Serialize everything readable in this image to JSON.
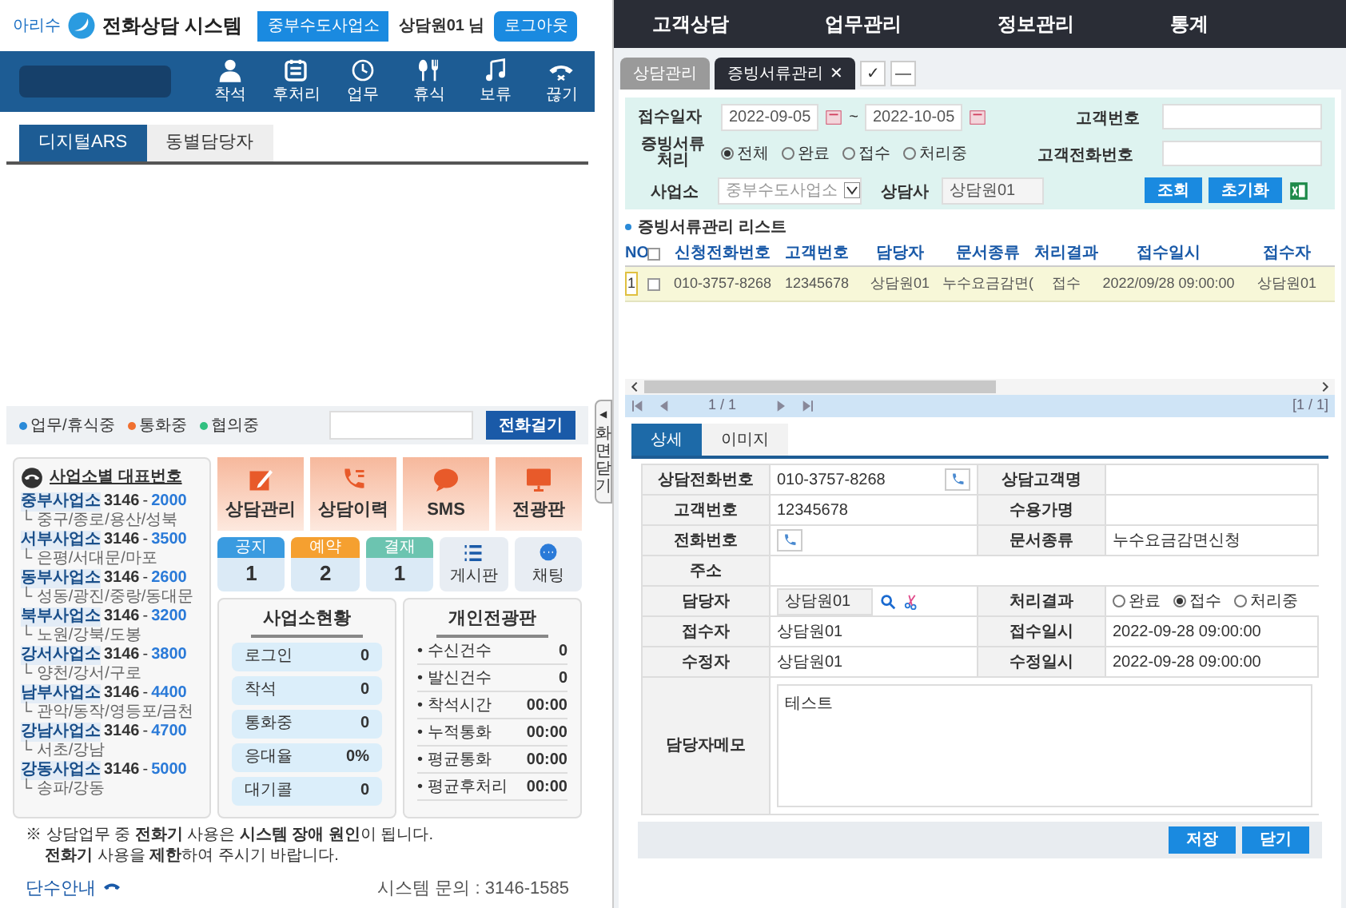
{
  "header": {
    "logo": "아리수",
    "title": "전화상담 시스템",
    "office": "중부수도사업소",
    "user": "상담원01 님",
    "logout": "로그아웃"
  },
  "toolbar": [
    {
      "label": "착석"
    },
    {
      "label": "후처리"
    },
    {
      "label": "업무"
    },
    {
      "label": "휴식"
    },
    {
      "label": "보류"
    },
    {
      "label": "끊기"
    }
  ],
  "left_tabs": [
    {
      "label": "디지털ARS",
      "selected": true
    },
    {
      "label": "동별담당자",
      "selected": false
    }
  ],
  "legend": [
    {
      "label": "업무/휴식중",
      "color": "#2a8ad8"
    },
    {
      "label": "통화중",
      "color": "#f07030"
    },
    {
      "label": "협의중",
      "color": "#30c080"
    }
  ],
  "dial_button": "전화걸기",
  "side_handle": {
    "arrow": "◀",
    "label": "화면닫기"
  },
  "offices": {
    "title": "사업소별 대표번호",
    "items": [
      {
        "name": "중부사업소",
        "prefix": "3146",
        "sep": "-",
        "number": "2000",
        "areas": "└ 중구/종로/용산/성북"
      },
      {
        "name": "서부사업소",
        "prefix": "3146",
        "sep": "-",
        "number": "3500",
        "areas": "└ 은평/서대문/마포"
      },
      {
        "name": "동부사업소",
        "prefix": "3146",
        "sep": "-",
        "number": "2600",
        "areas": "└ 성동/광진/중랑/동대문"
      },
      {
        "name": "북부사업소",
        "prefix": "3146",
        "sep": "-",
        "number": "3200",
        "areas": "└ 노원/강북/도봉"
      },
      {
        "name": "강서사업소",
        "prefix": "3146",
        "sep": "-",
        "number": "3800",
        "areas": "└ 양천/강서/구로"
      },
      {
        "name": "남부사업소",
        "prefix": "3146",
        "sep": "-",
        "number": "4400",
        "areas": "└ 관악/동작/영등포/금천"
      },
      {
        "name": "강남사업소",
        "prefix": "3146",
        "sep": "-",
        "number": "4700",
        "areas": "└ 서초/강남"
      },
      {
        "name": "강동사업소",
        "prefix": "3146",
        "sep": "-",
        "number": "5000",
        "areas": "└ 송파/강동"
      }
    ]
  },
  "menu_tiles": [
    {
      "label": "상담관리"
    },
    {
      "label": "상담이력"
    },
    {
      "label": "SMS"
    },
    {
      "label": "전광판"
    }
  ],
  "counters": [
    {
      "label": "공지",
      "count": "1",
      "color": "#3a9be0"
    },
    {
      "label": "예약",
      "count": "2",
      "color": "#f5a030"
    },
    {
      "label": "결재",
      "count": "1",
      "color": "#6cc4b0"
    }
  ],
  "shortcuts": [
    {
      "label": "게시판"
    },
    {
      "label": "채팅"
    }
  ],
  "office_status": {
    "title": "사업소현황",
    "rows": [
      {
        "label": "로그인",
        "value": "0"
      },
      {
        "label": "착석",
        "value": "0"
      },
      {
        "label": "통화중",
        "value": "0"
      },
      {
        "label": "응대율",
        "value": "0%"
      },
      {
        "label": "대기콜",
        "value": "0"
      }
    ]
  },
  "personal_board": {
    "title": "개인전광판",
    "rows": [
      {
        "label": "• 수신건수",
        "value": "0"
      },
      {
        "label": "• 발신건수",
        "value": "0"
      },
      {
        "label": "• 착석시간",
        "value": "00:00"
      },
      {
        "label": "• 누적통화",
        "value": "00:00"
      },
      {
        "label": "• 평균통화",
        "value": "00:00"
      },
      {
        "label": "• 평균후처리",
        "value": "00:00"
      }
    ]
  },
  "notice": [
    "※ 상담업무 중 **전화기** 사용은 **시스템 장애 원인**이 됩니다.",
    "**전화기** 사용을 **제한**하여 주시기 바랍니다."
  ],
  "footer": {
    "outage": "단수안내",
    "inquiry": "시스템 문의 : 3146-1585"
  },
  "nav": [
    {
      "label": "고객상담"
    },
    {
      "label": "업무관리"
    },
    {
      "label": "정보관리"
    },
    {
      "label": "통계"
    }
  ],
  "tabs": [
    {
      "label": "상담관리",
      "selected": false
    },
    {
      "label": "증빙서류관리",
      "selected": true,
      "close": "✕"
    }
  ],
  "tab_actions": [
    "✓",
    "—"
  ],
  "search": {
    "date_label": "접수일자",
    "date_from": "2022-09-05",
    "tilde": "~",
    "date_to": "2022-10-05",
    "customer_no_label": "고객번호",
    "doc_label": "증빙서류 처리",
    "doc_options": [
      {
        "label": "전체",
        "selected": true
      },
      {
        "label": "완료",
        "selected": false
      },
      {
        "label": "접수",
        "selected": false
      },
      {
        "label": "처리중",
        "selected": false
      }
    ],
    "customer_phone_label": "고객전화번호",
    "office_label": "사업소",
    "office_value": "중부수도사업소",
    "counselor_label": "상담사",
    "counselor_value": "상담원01",
    "buttons": [
      "조회",
      "초기화"
    ]
  },
  "list": {
    "title": "증빙서류관리 리스트",
    "columns": [
      "NO",
      "신청전화번호",
      "고객번호",
      "담당자",
      "문서종류",
      "처리결과",
      "접수일시",
      "접수자"
    ],
    "header_checked": false,
    "rows": [
      {
        "selected": true,
        "checked": false,
        "cells": [
          "1",
          "010-3757-8268",
          "12345678",
          "상담원01",
          "누수요금감면(",
          "접수",
          "2022/09/28 09:00:00",
          "상담원01"
        ]
      }
    ],
    "pager": "1 / 1",
    "total": "[1 / 1]"
  },
  "detail": {
    "tabs": [
      {
        "label": "상세",
        "selected": true
      },
      {
        "label": "이미지",
        "selected": false
      }
    ],
    "cells": [
      {
        "kind": "phone",
        "label": "상담전화번호",
        "value": "010-3757-8268"
      },
      {
        "kind": "text",
        "label": "상담고객명"
      },
      {
        "kind": "text",
        "label": "고객번호",
        "value": "12345678"
      },
      {
        "kind": "text",
        "label": "수용가명"
      },
      {
        "kind": "phone",
        "label": "전화번호"
      },
      {
        "kind": "text",
        "label": "문서종류",
        "value": "누수요금감면신청"
      },
      {
        "kind": "wide",
        "label": "주소"
      },
      {
        "kind": "picker",
        "label": "담당자",
        "value": "상담원01"
      },
      {
        "kind": "radio",
        "label": "처리결과",
        "options": [
          {
            "label": "완료",
            "selected": false
          },
          {
            "label": "접수",
            "selected": true
          },
          {
            "label": "처리중",
            "selected": false
          }
        ]
      },
      {
        "kind": "text",
        "label": "접수자",
        "value": "상담원01"
      },
      {
        "kind": "text",
        "label": "접수일시",
        "value": "2022-09-28 09:00:00"
      },
      {
        "kind": "text",
        "label": "수정자",
        "value": "상담원01"
      },
      {
        "kind": "text",
        "label": "수정일시",
        "value": "2022-09-28 09:00:00"
      },
      {
        "kind": "memo",
        "label": "담당자메모",
        "value": "테스트"
      }
    ]
  },
  "actions": [
    "저장",
    "닫기"
  ]
}
